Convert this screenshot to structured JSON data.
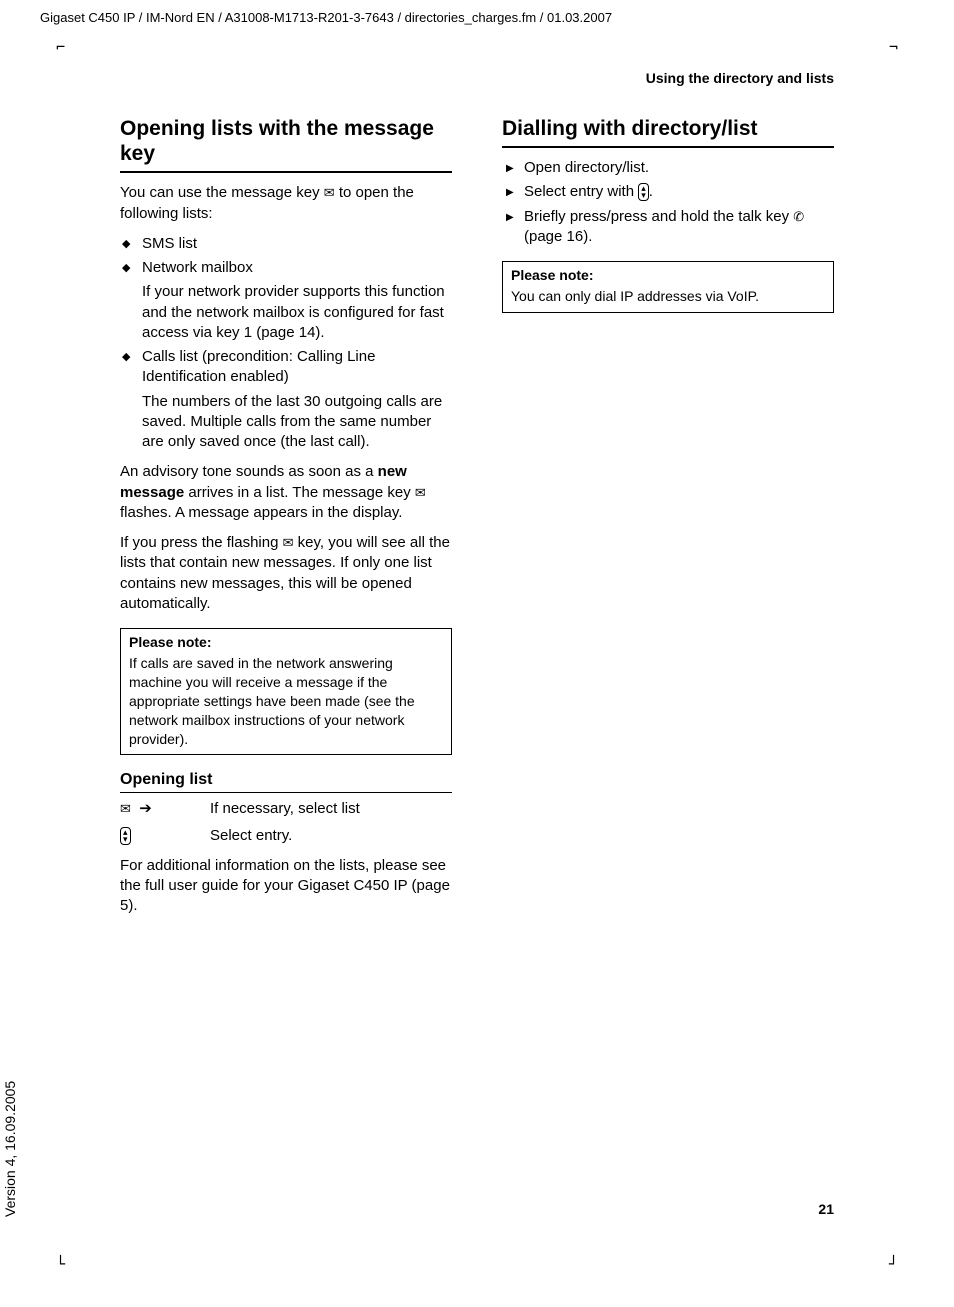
{
  "header": "Gigaset C450 IP / IM-Nord EN / A31008-M1713-R201-3-7643 / directories_charges.fm / 01.03.2007",
  "sectionHeader": "Using the directory and lists",
  "version": "Version 4, 16.09.2005",
  "pageNumber": "21",
  "left": {
    "h2": "Opening lists with the message key",
    "intro_a": "You can use the message key ",
    "intro_b": " to open the following lists:",
    "bullets": {
      "b1": "SMS list",
      "b2": "Network mailbox",
      "b2sub": "If your network provider supports this function and the network mailbox is configured for fast access via key 1 (page 14).",
      "b3": "Calls list (precondition: Calling Line Identification enabled)",
      "b3sub": "The numbers of the last 30 outgoing calls are saved. Multiple calls from the same number are only saved once (the last call)."
    },
    "p2_a": "An advisory tone sounds as soon as a ",
    "p2_bold": "new message",
    "p2_b": " arrives in a list. The message key ",
    "p2_c": " flashes. A message appears in the display.",
    "p3_a": "If you press the flashing ",
    "p3_b": " key, you will see all the lists that contain new messages. If only one list contains new messages, this will be opened automatically.",
    "note1": {
      "title": "Please note:",
      "body": "If calls are saved in the network answering machine you will receive a message if the appropriate settings have been made (see the network mailbox instructions of your network provider)."
    },
    "h3": "Opening list",
    "step1": "If necessary, select list",
    "step2": "Select entry.",
    "p4": "For additional information on the lists, please see the full user guide for your Gigaset C450 IP (page 5)."
  },
  "right": {
    "h2": "Dialling with directory/list",
    "arrows": {
      "a1": "Open directory/list.",
      "a2_a": "Select entry with ",
      "a2_b": ".",
      "a3_a": "Briefly press/press and hold the talk key ",
      "a3_b": " (page 16)."
    },
    "note2": {
      "title": "Please note:",
      "body": "You can only dial IP addresses via VoIP."
    }
  }
}
